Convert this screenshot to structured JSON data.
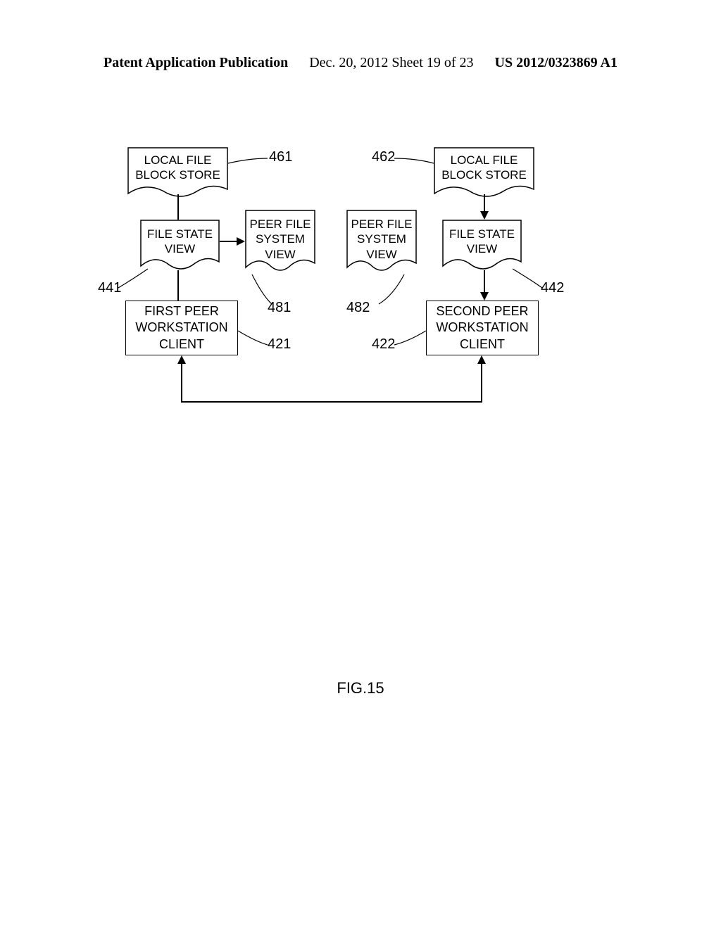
{
  "header": {
    "left": "Patent Application Publication",
    "center": "Dec. 20, 2012  Sheet 19 of 23",
    "right": "US 2012/0323869 A1"
  },
  "boxes": {
    "local_file_block_store_left": "LOCAL FILE\nBLOCK STORE",
    "local_file_block_store_right": "LOCAL FILE\nBLOCK STORE",
    "file_state_view_left": "FILE STATE\nVIEW",
    "file_state_view_right": "FILE STATE\nVIEW",
    "peer_file_system_view_left": "PEER FILE\nSYSTEM\nVIEW",
    "peer_file_system_view_right": "PEER FILE\nSYSTEM\nVIEW",
    "first_peer_client": "FIRST PEER\nWORKSTATION\nCLIENT",
    "second_peer_client": "SECOND PEER\nWORKSTATION\nCLIENT"
  },
  "labels": {
    "ref_461": "461",
    "ref_462": "462",
    "ref_441": "441",
    "ref_442": "442",
    "ref_481": "481",
    "ref_482": "482",
    "ref_421": "421",
    "ref_422": "422"
  },
  "figure": "FIG.15"
}
